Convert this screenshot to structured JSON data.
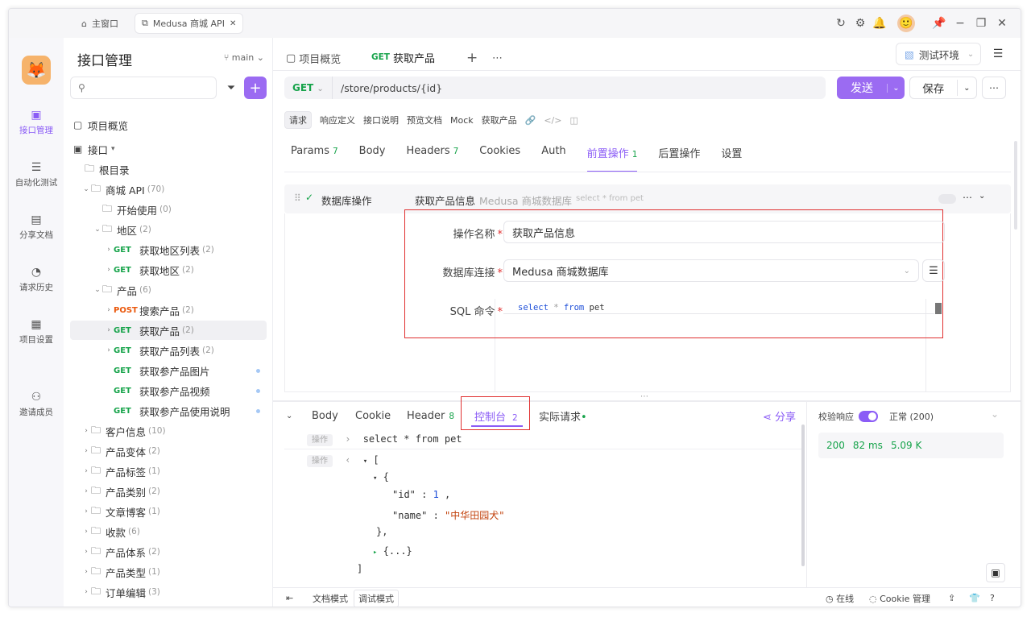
{
  "window_tabs": [
    {
      "label": "主窗口"
    },
    {
      "label": "Medusa 商城 API"
    }
  ],
  "nav": [
    {
      "label": "接口管理",
      "icon": "api-icon"
    },
    {
      "label": "自动化测试",
      "icon": "automation-icon"
    },
    {
      "label": "分享文档",
      "icon": "doc-icon"
    },
    {
      "label": "请求历史",
      "icon": "history-icon"
    },
    {
      "label": "项目设置",
      "icon": "settings-icon"
    },
    {
      "label": "邀请成员",
      "icon": "invite-icon"
    }
  ],
  "tree": {
    "title": "接口管理",
    "branch": "main",
    "overview": "项目概览",
    "interfaces": "接口",
    "root": "根目录",
    "items": [
      {
        "type": "folder",
        "label": "商城 API",
        "count": "(70)",
        "arrow": "v"
      },
      {
        "type": "folder",
        "label": "开始使用",
        "count": "(0)",
        "arrow": ""
      },
      {
        "type": "folder",
        "label": "地区",
        "count": "(2)",
        "arrow": "v"
      },
      {
        "type": "api",
        "method": "GET",
        "label": "获取地区列表",
        "count": "(2)",
        "arrow": ">"
      },
      {
        "type": "api",
        "method": "GET",
        "label": "获取地区",
        "count": "(2)",
        "arrow": ">"
      },
      {
        "type": "folder",
        "label": "产品",
        "count": "(6)",
        "arrow": "v"
      },
      {
        "type": "api",
        "method": "POST",
        "label": "搜索产品",
        "count": "(2)",
        "arrow": ">"
      },
      {
        "type": "api",
        "method": "GET",
        "label": "获取产品",
        "count": "(2)",
        "arrow": ">"
      },
      {
        "type": "api",
        "method": "GET",
        "label": "获取产品列表",
        "count": "(2)",
        "arrow": ">"
      },
      {
        "type": "api",
        "method": "GET",
        "label": "获取参产品图片",
        "count": "",
        "arrow": ""
      },
      {
        "type": "api",
        "method": "GET",
        "label": "获取参产品视频",
        "count": "",
        "arrow": ""
      },
      {
        "type": "api",
        "method": "GET",
        "label": "获取参产品使用说明",
        "count": "",
        "arrow": ""
      },
      {
        "type": "folder",
        "label": "客户信息",
        "count": "(10)",
        "arrow": ">"
      },
      {
        "type": "folder",
        "label": "产品变体",
        "count": "(2)",
        "arrow": ">"
      },
      {
        "type": "folder",
        "label": "产品标签",
        "count": "(1)",
        "arrow": ">"
      },
      {
        "type": "folder",
        "label": "产品类别",
        "count": "(2)",
        "arrow": ">"
      },
      {
        "type": "folder",
        "label": "文章博客",
        "count": "(1)",
        "arrow": ">"
      },
      {
        "type": "folder",
        "label": "收款",
        "count": "(6)",
        "arrow": ">"
      },
      {
        "type": "folder",
        "label": "产品体系",
        "count": "(2)",
        "arrow": ">"
      },
      {
        "type": "folder",
        "label": "产品类型",
        "count": "(1)",
        "arrow": ">"
      },
      {
        "type": "folder",
        "label": "订单编辑",
        "count": "(3)",
        "arrow": ">"
      }
    ]
  },
  "tabs": {
    "overview": "项目概览",
    "active_method": "GET",
    "active_label": "获取产品",
    "env": "测试环境"
  },
  "url": {
    "method": "GET",
    "path": "/store/products/{id}"
  },
  "actions": {
    "send": "发送",
    "save": "保存"
  },
  "subbar": [
    "请求",
    "响应定义",
    "接口说明",
    "预览文档",
    "Mock",
    "获取产品"
  ],
  "req_tabs": [
    {
      "label": "Params",
      "n": "7"
    },
    {
      "label": "Body",
      "n": ""
    },
    {
      "label": "Headers",
      "n": "7"
    },
    {
      "label": "Cookies",
      "n": ""
    },
    {
      "label": "Auth",
      "n": ""
    },
    {
      "label": "前置操作",
      "n": "1"
    },
    {
      "label": "后置操作",
      "n": ""
    },
    {
      "label": "设置",
      "n": ""
    }
  ],
  "op": {
    "type": "数据库操作",
    "name": "获取产品信息",
    "db": "Medusa 商城数据库",
    "sql_preview": "select * from pet"
  },
  "form": {
    "name_label": "操作名称",
    "name_value": "获取产品信息",
    "db_label": "数据库连接",
    "db_value": "Medusa 商城数据库",
    "sql_label": "SQL 命令"
  },
  "resp_tabs": [
    {
      "label": "Body",
      "n": ""
    },
    {
      "label": "Cookie",
      "n": ""
    },
    {
      "label": "Header",
      "n": "8"
    },
    {
      "label": "控制台",
      "n": "2"
    },
    {
      "label": "实际请求",
      "n": ""
    }
  ],
  "share": "分享",
  "console": {
    "tag": "操作",
    "cmd": "select * from pet",
    "json": {
      "id_key": "\"id\"",
      "id_val": "1",
      "name_key": "\"name\"",
      "name_val": "\"中华田园犬\""
    },
    "collapsed": "{...}"
  },
  "verify": {
    "label": "校验响应",
    "status": "正常 (200)"
  },
  "metrics": {
    "code": "200",
    "time": "82 ms",
    "size": "5.09 K"
  },
  "footer": {
    "doc_mode": "文档模式",
    "debug_mode": "调试模式",
    "online": "在线",
    "cookie": "Cookie 管理"
  },
  "colors": {
    "accent": "#8b5cf6",
    "get": "#16a34a",
    "post": "#ea580c",
    "highlight_border": "#e03131"
  }
}
